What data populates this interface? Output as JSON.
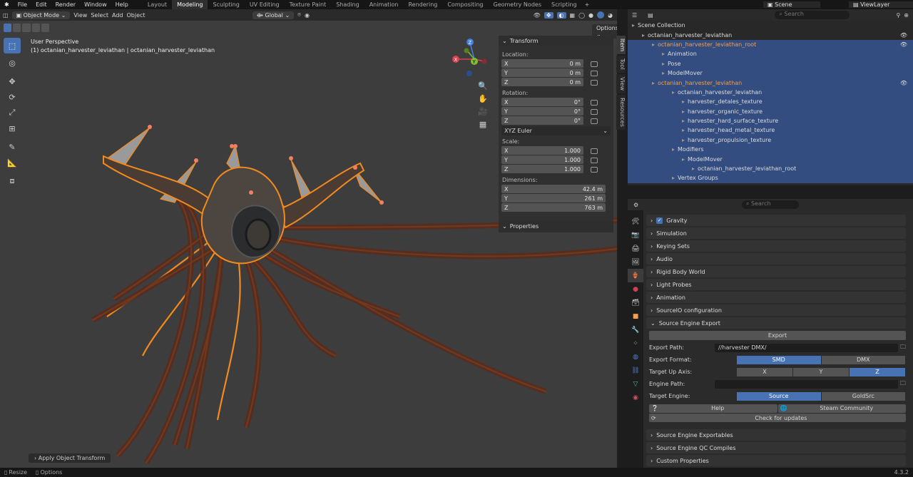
{
  "menu": [
    "File",
    "Edit",
    "Render",
    "Window",
    "Help"
  ],
  "workspaces": [
    "Layout",
    "Modeling",
    "Sculpting",
    "UV Editing",
    "Texture Paint",
    "Shading",
    "Animation",
    "Rendering",
    "Compositing",
    "Geometry Nodes",
    "Scripting"
  ],
  "active_workspace": "Modeling",
  "scene": "Scene",
  "view_layer": "ViewLayer",
  "vp_header": {
    "mode": "Object Mode",
    "menus": [
      "View",
      "Select",
      "Add",
      "Object"
    ],
    "orientation": "Global",
    "options": "Options"
  },
  "viewport": {
    "title": "User Perspective",
    "subtitle": "(1) octanian_harvester_leviathan | octanian_harvester_leviathan",
    "last_op": "Apply Object Transform"
  },
  "transform": {
    "title": "Transform",
    "location": "Location:",
    "rotation": "Rotation:",
    "scale": "Scale:",
    "dimensions": "Dimensions:",
    "loc": [
      [
        "X",
        "0 m"
      ],
      [
        "Y",
        "0 m"
      ],
      [
        "Z",
        "0 m"
      ]
    ],
    "rot": [
      [
        "X",
        "0°"
      ],
      [
        "Y",
        "0°"
      ],
      [
        "Z",
        "0°"
      ]
    ],
    "rot_mode": "XYZ Euler",
    "scl": [
      [
        "X",
        "1.000"
      ],
      [
        "Y",
        "1.000"
      ],
      [
        "Z",
        "1.000"
      ]
    ],
    "dim": [
      [
        "X",
        "42.4 m"
      ],
      [
        "Y",
        "261 m"
      ],
      [
        "Z",
        "763 m"
      ]
    ],
    "properties": "Properties"
  },
  "side_tabs": [
    "Item",
    "Tool",
    "View",
    "Resources"
  ],
  "outliner": {
    "search": "Search",
    "rows": [
      {
        "t": "Scene Collection",
        "i": 6,
        "c": "#ddd"
      },
      {
        "t": "octanian_harvester_leviathan",
        "i": 20,
        "c": "#ddd"
      },
      {
        "t": "octanian_harvester_leviathan_root",
        "i": 34,
        "c": "#f0a050",
        "s": true
      },
      {
        "t": "Animation",
        "i": 48,
        "c": "#ddd",
        "s": true
      },
      {
        "t": "Pose",
        "i": 48,
        "c": "#ddd",
        "s": true
      },
      {
        "t": "ModelMover",
        "i": 48,
        "c": "#ddd",
        "s": true
      },
      {
        "t": "octanian_harvester_leviathan",
        "i": 34,
        "c": "#f0a050",
        "s": true
      },
      {
        "t": "octanian_harvester_leviathan",
        "i": 62,
        "c": "#ddd",
        "s": true
      },
      {
        "t": "harvester_detales_texture",
        "i": 76,
        "c": "#ddd",
        "s": true
      },
      {
        "t": "harvester_organic_texture",
        "i": 76,
        "c": "#ddd",
        "s": true
      },
      {
        "t": "harvester_hard_surface_texture",
        "i": 76,
        "c": "#ddd",
        "s": true
      },
      {
        "t": "harvester_head_metal_texture",
        "i": 76,
        "c": "#ddd",
        "s": true
      },
      {
        "t": "harvester_propulsion_texture",
        "i": 76,
        "c": "#ddd",
        "s": true
      },
      {
        "t": "Modifiers",
        "i": 62,
        "c": "#ddd",
        "s": true
      },
      {
        "t": "ModelMover",
        "i": 76,
        "c": "#ddd",
        "s": true
      },
      {
        "t": "octanian_harvester_leviathan_root",
        "i": 90,
        "c": "#ddd",
        "s": true
      },
      {
        "t": "Vertex Groups",
        "i": 62,
        "c": "#ddd",
        "s": true
      }
    ]
  },
  "props": {
    "search": "Search",
    "panels_top": [
      "Gravity",
      "Simulation",
      "Keying Sets",
      "Audio",
      "Rigid Body World",
      "Light Probes",
      "Animation",
      "SourceIO configuration",
      "Source Engine Export"
    ],
    "export_btn": "Export",
    "export_path_label": "Export Path:",
    "export_path": "//harvester DMX/",
    "format_label": "Export Format:",
    "formats": [
      "SMD",
      "DMX"
    ],
    "axis_label": "Target Up Axis:",
    "axes": [
      "X",
      "Y",
      "Z"
    ],
    "engine_path_label": "Engine Path:",
    "target_engine_label": "Target Engine:",
    "engines": [
      "Source",
      "GoldSrc"
    ],
    "help": "Help",
    "community": "Steam Community",
    "updates": "Check for updates",
    "panels_bottom": [
      "Source Engine Exportables",
      "Source Engine QC Compiles",
      "Custom Properties"
    ]
  },
  "status": {
    "resize": "Resize",
    "options": "Options",
    "version": "4.3.2"
  },
  "colors": {
    "accent": "#4772b3",
    "selection": "#f28a1f",
    "x": "#e04050",
    "y": "#80c030",
    "z": "#4080e0"
  }
}
